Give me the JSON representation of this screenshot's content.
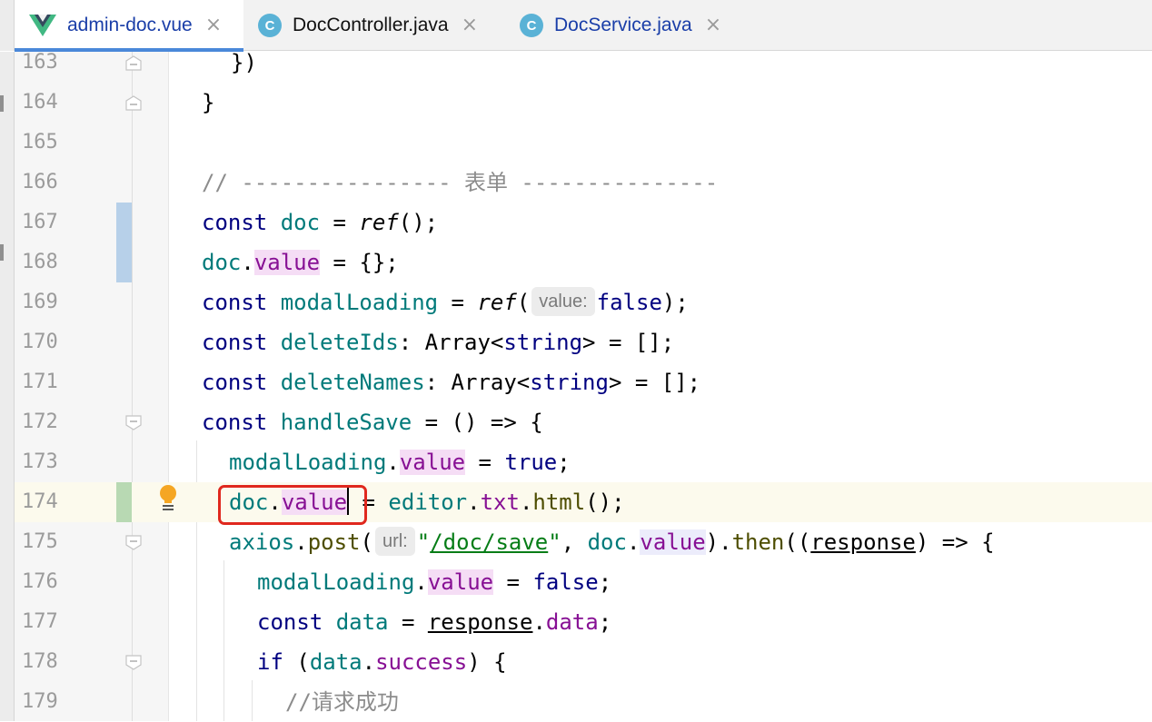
{
  "tabs": [
    {
      "label": "admin-doc.vue",
      "icon": "vue-icon",
      "active": true,
      "color": "#1a3ea8"
    },
    {
      "label": "DocController.java",
      "icon": "java-class-icon",
      "active": false,
      "color": "#111111"
    },
    {
      "label": "DocService.java",
      "icon": "java-class-icon",
      "active": false,
      "color": "#1a3ea8"
    }
  ],
  "tab_close_glyph": "×",
  "class_icon_letter": "C",
  "lines": [
    {
      "num": "163"
    },
    {
      "num": "164"
    },
    {
      "num": "165"
    },
    {
      "num": "166"
    },
    {
      "num": "167"
    },
    {
      "num": "168"
    },
    {
      "num": "169"
    },
    {
      "num": "170"
    },
    {
      "num": "171"
    },
    {
      "num": "172"
    },
    {
      "num": "173"
    },
    {
      "num": "174"
    },
    {
      "num": "175"
    },
    {
      "num": "176"
    },
    {
      "num": "177"
    },
    {
      "num": "178"
    },
    {
      "num": "179"
    }
  ],
  "code": {
    "l163": {
      "a": "})"
    },
    "l164": {
      "a": "}"
    },
    "l166": {
      "a": "// ---------------- 表单 ---------------"
    },
    "l167": {
      "kw": "const",
      "v": "doc",
      "eq": " = ",
      "fn": "ref",
      "end": "();"
    },
    "l168": {
      "v": "doc",
      "dot": ".",
      "p": "value",
      "end": " = {};"
    },
    "l169": {
      "kw": "const",
      "v": "modalLoading",
      "eq": " = ",
      "fn": "ref",
      "po": "(",
      "hint": "value:",
      "lit": "false",
      "end": ");"
    },
    "l170": {
      "kw": "const",
      "v": "deleteIds",
      "mid": ": Array<",
      "t": "string",
      "end": "> = [];"
    },
    "l171": {
      "kw": "const",
      "v": "deleteNames",
      "mid": ": Array<",
      "t": "string",
      "end": "> = [];"
    },
    "l172": {
      "kw": "const",
      "v": "handleSave",
      "end": " = () => {"
    },
    "l173": {
      "v": "modalLoading",
      "dot": ".",
      "p": "value",
      "eq": " = ",
      "lit": "true",
      "end": ";"
    },
    "l174": {
      "v": "doc",
      "dot": ".",
      "p": "value",
      "eq": " = ",
      "v2": "editor",
      "d2": ".",
      "p2": "txt",
      "d3": ".",
      "f": "html",
      "end": "();"
    },
    "l175": {
      "v": "axios",
      "dot": ".",
      "f": "post",
      "po": "(",
      "hint": "url:",
      "q1": "\"",
      "s": "/doc/save",
      "q2": "\"",
      "cm": ", ",
      "v2": "doc",
      "d2": ".",
      "p": "value",
      "pc": ").",
      "f2": "then",
      "pp": "((",
      "arg": "response",
      "end": ") => {"
    },
    "l176": {
      "v": "modalLoading",
      "dot": ".",
      "p": "value",
      "eq": " = ",
      "lit": "false",
      "end": ";"
    },
    "l177": {
      "kw": "const",
      "v": "data",
      "eq": " = ",
      "arg": "response",
      "dot": ".",
      "p": "data",
      "end": ";"
    },
    "l178": {
      "kw": "if",
      "po": " (",
      "v": "data",
      "dot": ".",
      "p": "success",
      "end": ") {"
    },
    "l179": {
      "c": "//请求成功"
    }
  },
  "colors": {
    "accent": "#4a88d9",
    "highlight_box": "#e0281e",
    "current_line": "#fcfaed",
    "keyword": "#000080",
    "variable": "#007a7a",
    "string": "#067d17",
    "property": "#871094"
  }
}
